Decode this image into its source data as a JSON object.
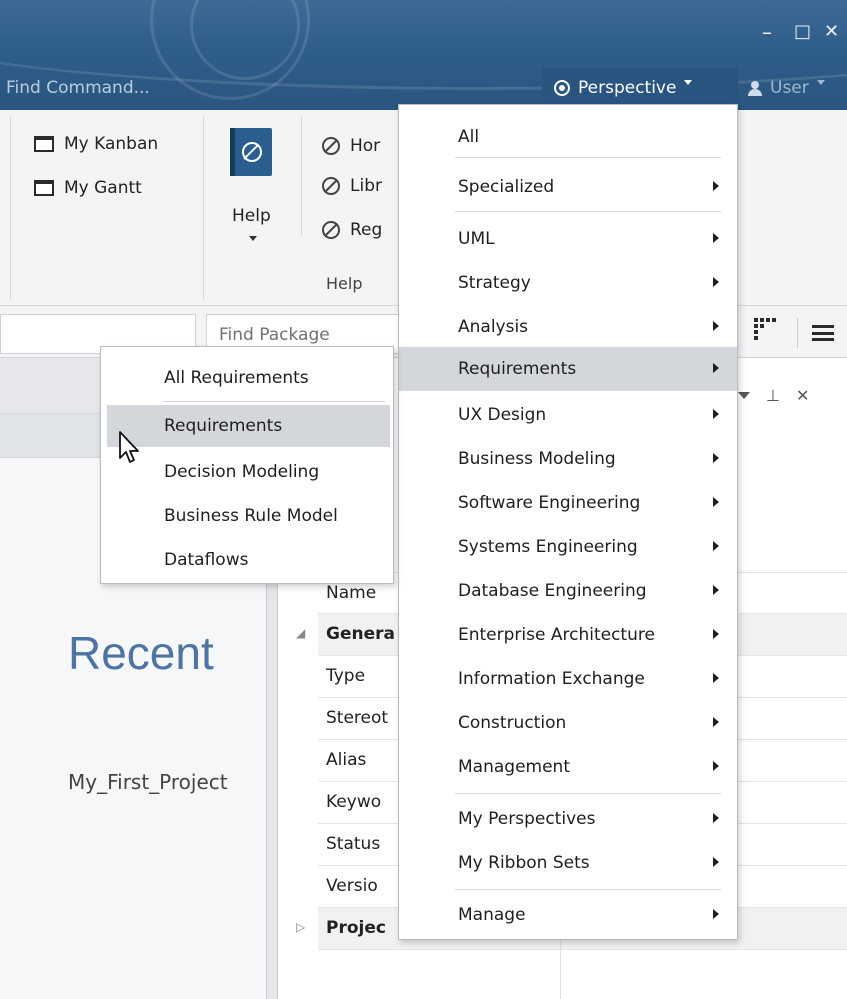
{
  "titlebar": {
    "find_command": "Find Command...",
    "perspective_label": "Perspective",
    "user_label": "User",
    "minimize_glyph": "–",
    "maximize_glyph": "□",
    "close_glyph": "✕"
  },
  "ribbon": {
    "my_kanban": "My Kanban",
    "my_gantt": "My Gantt",
    "help_button": "Help",
    "help_links": [
      "Hor",
      "Libr",
      "Reg"
    ],
    "help_group_label": "Help"
  },
  "toolbar": {
    "find_package_placeholder": "Find Package"
  },
  "left_panel": {
    "recent_heading": "Recent",
    "recent_projects": [
      "My_First_Project"
    ]
  },
  "properties": {
    "rows": [
      {
        "label": "Name",
        "kind": "field"
      },
      {
        "label": "Genera",
        "kind": "category"
      },
      {
        "label": "Type",
        "kind": "field"
      },
      {
        "label": "Stereot",
        "kind": "field"
      },
      {
        "label": "Alias",
        "kind": "field"
      },
      {
        "label": "Keywo",
        "kind": "field"
      },
      {
        "label": "Status",
        "kind": "field"
      },
      {
        "label": "Versio",
        "kind": "field"
      },
      {
        "label": "Projec",
        "kind": "category"
      }
    ],
    "pin_glyph": "⊥",
    "close_glyph": "✕"
  },
  "perspective_menu": {
    "items": [
      {
        "label": "All",
        "submenu": false
      },
      {
        "label": "Specialized",
        "submenu": true
      },
      {
        "label": "UML",
        "submenu": true
      },
      {
        "label": "Strategy",
        "submenu": true
      },
      {
        "label": "Analysis",
        "submenu": true
      },
      {
        "label": "Requirements",
        "submenu": true,
        "highlighted": true
      },
      {
        "label": "UX Design",
        "submenu": true
      },
      {
        "label": "Business Modeling",
        "submenu": true
      },
      {
        "label": "Software Engineering",
        "submenu": true
      },
      {
        "label": "Systems Engineering",
        "submenu": true
      },
      {
        "label": "Database Engineering",
        "submenu": true
      },
      {
        "label": "Enterprise Architecture",
        "submenu": true
      },
      {
        "label": "Information Exchange",
        "submenu": true
      },
      {
        "label": "Construction",
        "submenu": true
      },
      {
        "label": "Management",
        "submenu": true
      },
      {
        "label": "My Perspectives",
        "submenu": true
      },
      {
        "label": "My Ribbon Sets",
        "submenu": true
      },
      {
        "label": "Manage",
        "submenu": true
      }
    ]
  },
  "requirements_submenu": {
    "items": [
      {
        "label": "All Requirements"
      },
      {
        "label": "Requirements",
        "highlighted": true
      },
      {
        "label": "Decision Modeling"
      },
      {
        "label": "Business Rule Model"
      },
      {
        "label": "Dataflows"
      }
    ]
  },
  "colors": {
    "titlebar": "#2f5d8a",
    "accent_text": "#4d74a3",
    "menu_highlight": "#d3d6da"
  }
}
